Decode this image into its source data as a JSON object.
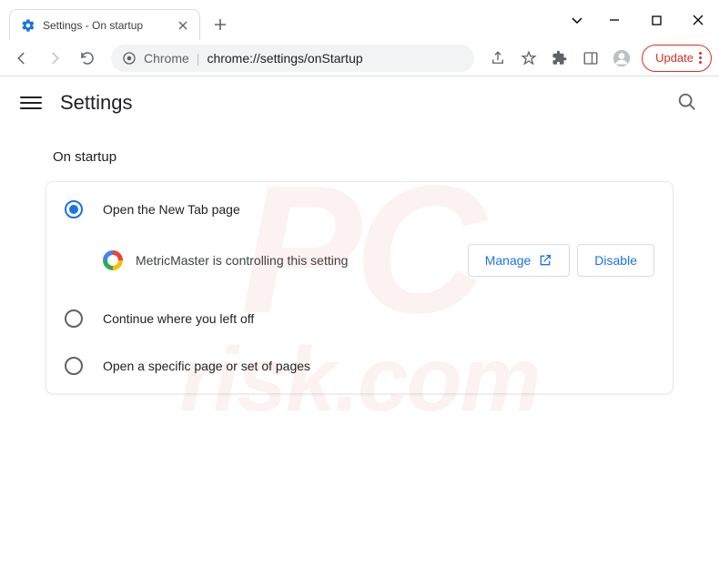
{
  "window": {
    "tab_title": "Settings - On startup"
  },
  "omnibox": {
    "prefix": "Chrome",
    "url": "chrome://settings/onStartup"
  },
  "update_button": {
    "label": "Update"
  },
  "settings": {
    "title": "Settings",
    "section_title": "On startup",
    "options": [
      {
        "label": "Open the New Tab page",
        "selected": true
      },
      {
        "label": "Continue where you left off",
        "selected": false
      },
      {
        "label": "Open a specific page or set of pages",
        "selected": false
      }
    ],
    "controlled_by": {
      "extension_name": "MetricMaster",
      "text": "MetricMaster is controlling this setting",
      "manage_label": "Manage",
      "disable_label": "Disable"
    }
  },
  "watermark": {
    "line1": "PC",
    "line2": "risk.com"
  }
}
